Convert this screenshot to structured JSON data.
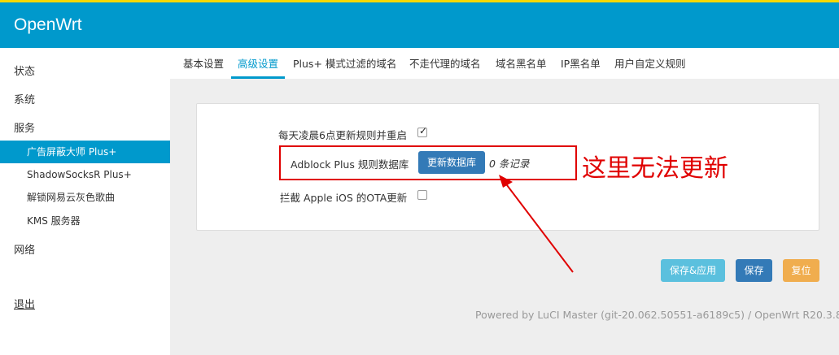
{
  "app": {
    "brand": "OpenWrt"
  },
  "sidebar": {
    "items": [
      {
        "label": "状态"
      },
      {
        "label": "系统"
      },
      {
        "label": "服务"
      }
    ],
    "sub_items": [
      {
        "label": "广告屏蔽大师 Plus+",
        "active": true
      },
      {
        "label": "ShadowSocksR Plus+"
      },
      {
        "label": "解锁网易云灰色歌曲"
      },
      {
        "label": "KMS 服务器"
      }
    ],
    "network": "网络",
    "logout": "退出"
  },
  "tabs": [
    {
      "label": "基本设置"
    },
    {
      "label": "高级设置",
      "active": true
    },
    {
      "label": "Plus+ 模式过滤的域名"
    },
    {
      "label": "不走代理的域名"
    },
    {
      "label": "域名黑名单"
    },
    {
      "label": "IP黑名单"
    },
    {
      "label": "用户自定义规则"
    }
  ],
  "form": {
    "daily_update_label": "每天凌晨6点更新规则并重启",
    "daily_update_checked": true,
    "db_label": "Adblock Plus 规则数据库",
    "update_button": "更新数据库",
    "record_count": "0 条记录",
    "ota_label": "拦截 Apple iOS 的OTA更新",
    "ota_checked": false
  },
  "actions": {
    "save_apply": "保存&应用",
    "save": "保存",
    "reset": "复位"
  },
  "annotation": {
    "text": "这里无法更新",
    "color": "#e00000"
  },
  "footer": {
    "text": "Powered by LuCI Master (git-20.062.50551-a6189c5) / OpenWrt R20.3.8"
  },
  "colors": {
    "accent": "#0099cc",
    "top_line": "#f5d800"
  }
}
